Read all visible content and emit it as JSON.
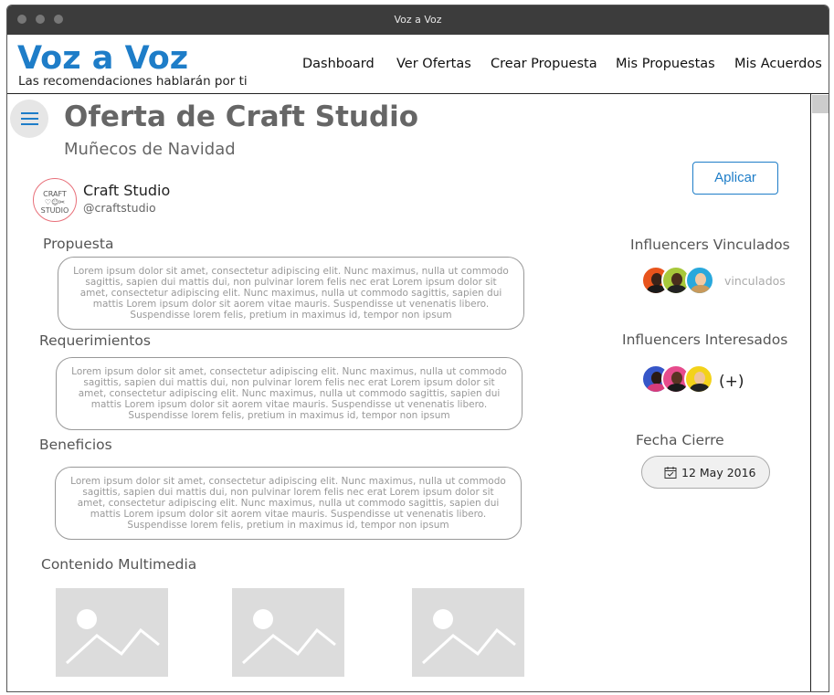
{
  "window": {
    "title": "Voz a Voz"
  },
  "app": {
    "logo": "Voz a Voz",
    "tagline": "Las recomendaciones hablarán por ti"
  },
  "nav": {
    "items": [
      "Dashboard",
      "Ver Ofertas",
      "Crear Propuesta",
      "Mis Propuestas",
      "Mis Acuerdos"
    ]
  },
  "page": {
    "title": "Oferta de Craft Studio",
    "subtitle": "Muñecos de Navidad",
    "apply_label": "Aplicar"
  },
  "company": {
    "name": "Craft Studio",
    "handle": "@craftstudio",
    "logo_text": "CRAFT\n♡☺✂\nSTUDIO"
  },
  "sections": [
    {
      "label": "Propuesta",
      "text": "Lorem ipsum dolor sit amet, consectetur adipiscing elit. Nunc maximus, nulla ut commodo sagittis, sapien dui mattis dui, non pulvinar lorem felis nec erat Lorem ipsum dolor sit amet, consectetur adipiscing elit. Nunc maximus, nulla ut commodo sagittis, sapien dui mattis Lorem ipsum dolor sit aorem vitae mauris. Suspendisse ut venenatis libero. Suspendisse lorem felis, pretium in maximus id, tempor non ipsum"
    },
    {
      "label": "Requerimientos",
      "text": "Lorem ipsum dolor sit amet, consectetur adipiscing elit. Nunc maximus, nulla ut commodo sagittis, sapien dui mattis dui, non pulvinar lorem felis nec erat Lorem ipsum dolor sit amet, consectetur adipiscing elit. Nunc maximus, nulla ut commodo sagittis, sapien dui mattis Lorem ipsum dolor sit aorem vitae mauris. Suspendisse ut venenatis libero. Suspendisse lorem felis, pretium in maximus id, tempor non ipsum"
    },
    {
      "label": "Beneficios",
      "text": "Lorem ipsum dolor sit amet, consectetur adipiscing elit. Nunc maximus, nulla ut commodo sagittis, sapien dui mattis dui, non pulvinar lorem felis nec erat Lorem ipsum dolor sit amet, consectetur adipiscing elit. Nunc maximus, nulla ut commodo sagittis, sapien dui mattis Lorem ipsum dolor sit aorem vitae mauris. Suspendisse ut venenatis libero. Suspendisse lorem felis, pretium in maximus id, tempor non ipsum"
    }
  ],
  "multimedia": {
    "label": "Contenido Multimedia"
  },
  "sidebar": {
    "linked_title": "Influencers Vinculados",
    "linked_suffix": "vinculados",
    "interested_title": "Influencers Interesados",
    "interested_more": "(+)",
    "close_date_title": "Fecha Cierre",
    "close_date": "12 May 2016"
  },
  "colors": {
    "accent": "#1e7dc8",
    "titlebar": "#3c3c3c",
    "muted_text": "#999999"
  },
  "icons": {
    "menu": "hamburger-icon",
    "calendar": "calendar-icon",
    "placeholder": "image-placeholder-icon"
  }
}
